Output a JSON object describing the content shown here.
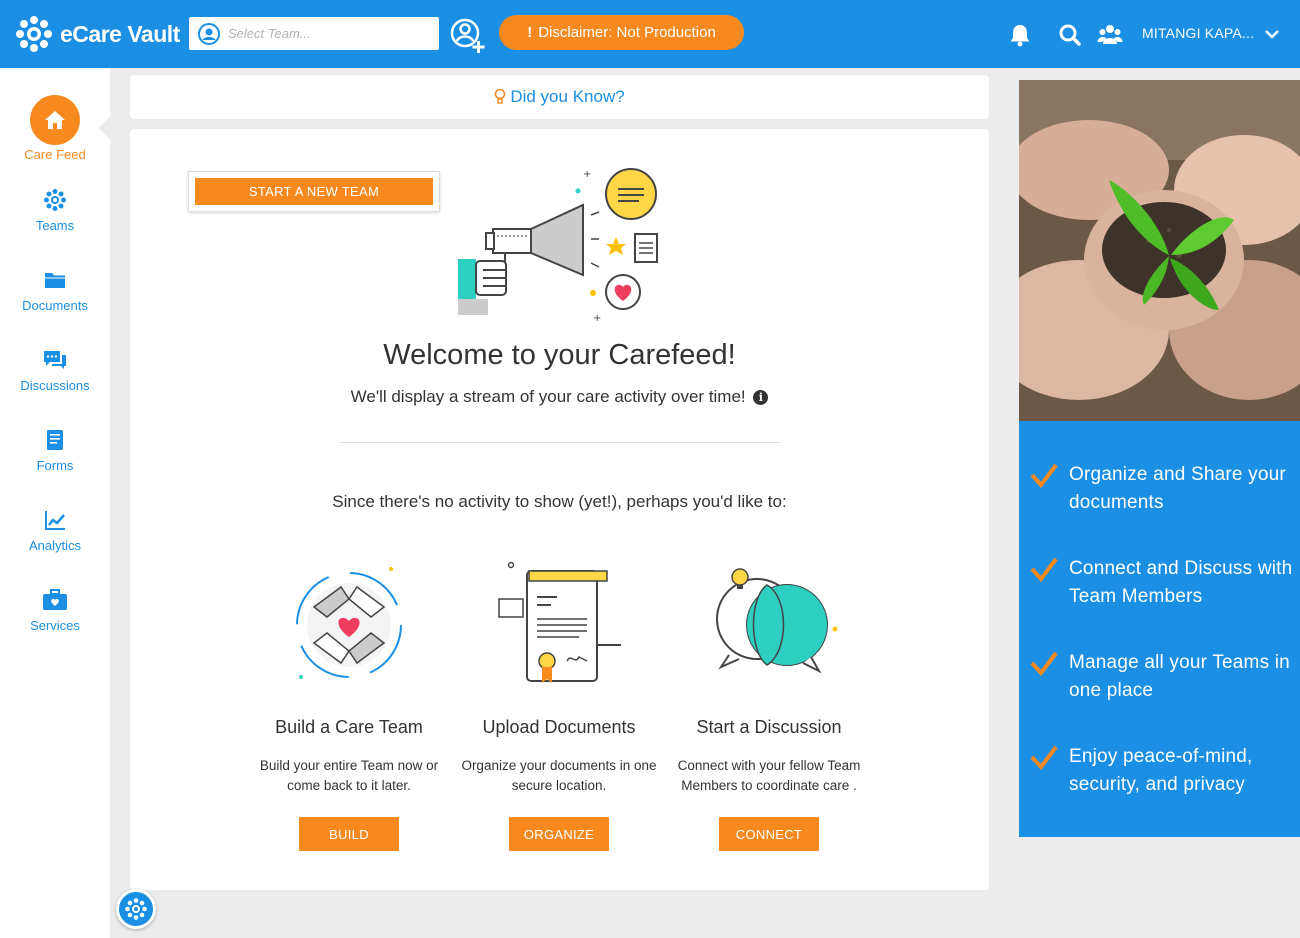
{
  "app": {
    "name": "eCare Vault"
  },
  "header": {
    "team_select_placeholder": "Select Team...",
    "disclaimer": "Disclaimer: Not Production",
    "disclaimer_mark": "!",
    "user_name": "MITANGI KAPA..."
  },
  "sidebar": {
    "items": [
      {
        "label": "Care Feed",
        "icon": "home-icon",
        "active": true
      },
      {
        "label": "Teams",
        "icon": "teams-icon"
      },
      {
        "label": "Documents",
        "icon": "folder-icon"
      },
      {
        "label": "Discussions",
        "icon": "chat-icon"
      },
      {
        "label": "Forms",
        "icon": "form-icon"
      },
      {
        "label": "Analytics",
        "icon": "chart-icon"
      },
      {
        "label": "Services",
        "icon": "briefcase-icon"
      }
    ]
  },
  "did_you_know": "Did you Know?",
  "main": {
    "start_team_button": "START A NEW TEAM",
    "welcome": "Welcome to your Carefeed!",
    "subtitle": "We'll display a stream of your care activity over time!",
    "info_glyph": "i",
    "prompt": "Since there's no activity to show (yet!), perhaps you'd like to:",
    "options": [
      {
        "title": "Build a Care Team",
        "desc": "Build your entire Team now or come back to it later.",
        "button": "BUILD"
      },
      {
        "title": "Upload Documents",
        "desc": "Organize your documents in one secure location.",
        "button": "ORGANIZE"
      },
      {
        "title": "Start a Discussion",
        "desc": "Connect with your fellow Team Members to coordinate care .",
        "button": "CONNECT"
      }
    ]
  },
  "benefits": [
    "Organize and Share your documents",
    "Connect and Discuss with Team Members",
    "Manage all your Teams in one place",
    "Enjoy peace-of-mind, security, and privacy"
  ],
  "colors": {
    "brand_blue": "#1a8fe3",
    "accent_orange": "#f7891f"
  }
}
